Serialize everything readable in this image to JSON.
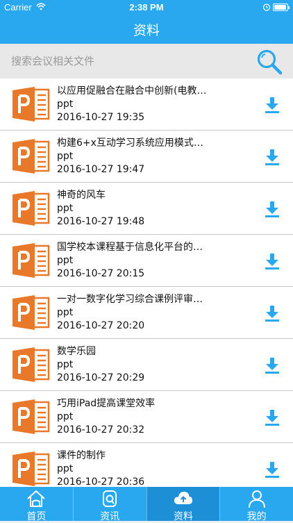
{
  "status_bar": {
    "carrier": "Carrier",
    "time": "2:38 PM"
  },
  "nav": {
    "title": "资料"
  },
  "search": {
    "placeholder": "搜索会议相关文件"
  },
  "files": [
    {
      "title": "以应用促融合在融合中创新(电教…",
      "type": "ppt",
      "date": "2016-10-27 19:35"
    },
    {
      "title": "构建6+x互动学习系统应用模式…",
      "type": "ppt",
      "date": "2016-10-27 19:47"
    },
    {
      "title": "神奇的风车",
      "type": "ppt",
      "date": "2016-10-27 19:48"
    },
    {
      "title": "国学校本课程基于信息化平台的…",
      "type": "ppt",
      "date": "2016-10-27 20:15"
    },
    {
      "title": "一对一数字化学习综合课例评审…",
      "type": "ppt",
      "date": "2016-10-27 20:20"
    },
    {
      "title": "数学乐园",
      "type": "ppt",
      "date": "2016-10-27 20:29"
    },
    {
      "title": "巧用iPad提高课堂效率",
      "type": "ppt",
      "date": "2016-10-27 20:32"
    },
    {
      "title": "课件的制作",
      "type": "ppt",
      "date": "2016-10-27 20:36"
    }
  ],
  "tabs": [
    {
      "label": "首页",
      "icon": "home-icon",
      "active": false
    },
    {
      "label": "资讯",
      "icon": "news-icon",
      "active": false
    },
    {
      "label": "资料",
      "icon": "cloud-icon",
      "active": true
    },
    {
      "label": "我的",
      "icon": "user-icon",
      "active": false
    }
  ],
  "colors": {
    "primary": "#2aa8ef",
    "tab_active": "#1c8fd6",
    "ppt_orange": "#e8782a"
  }
}
